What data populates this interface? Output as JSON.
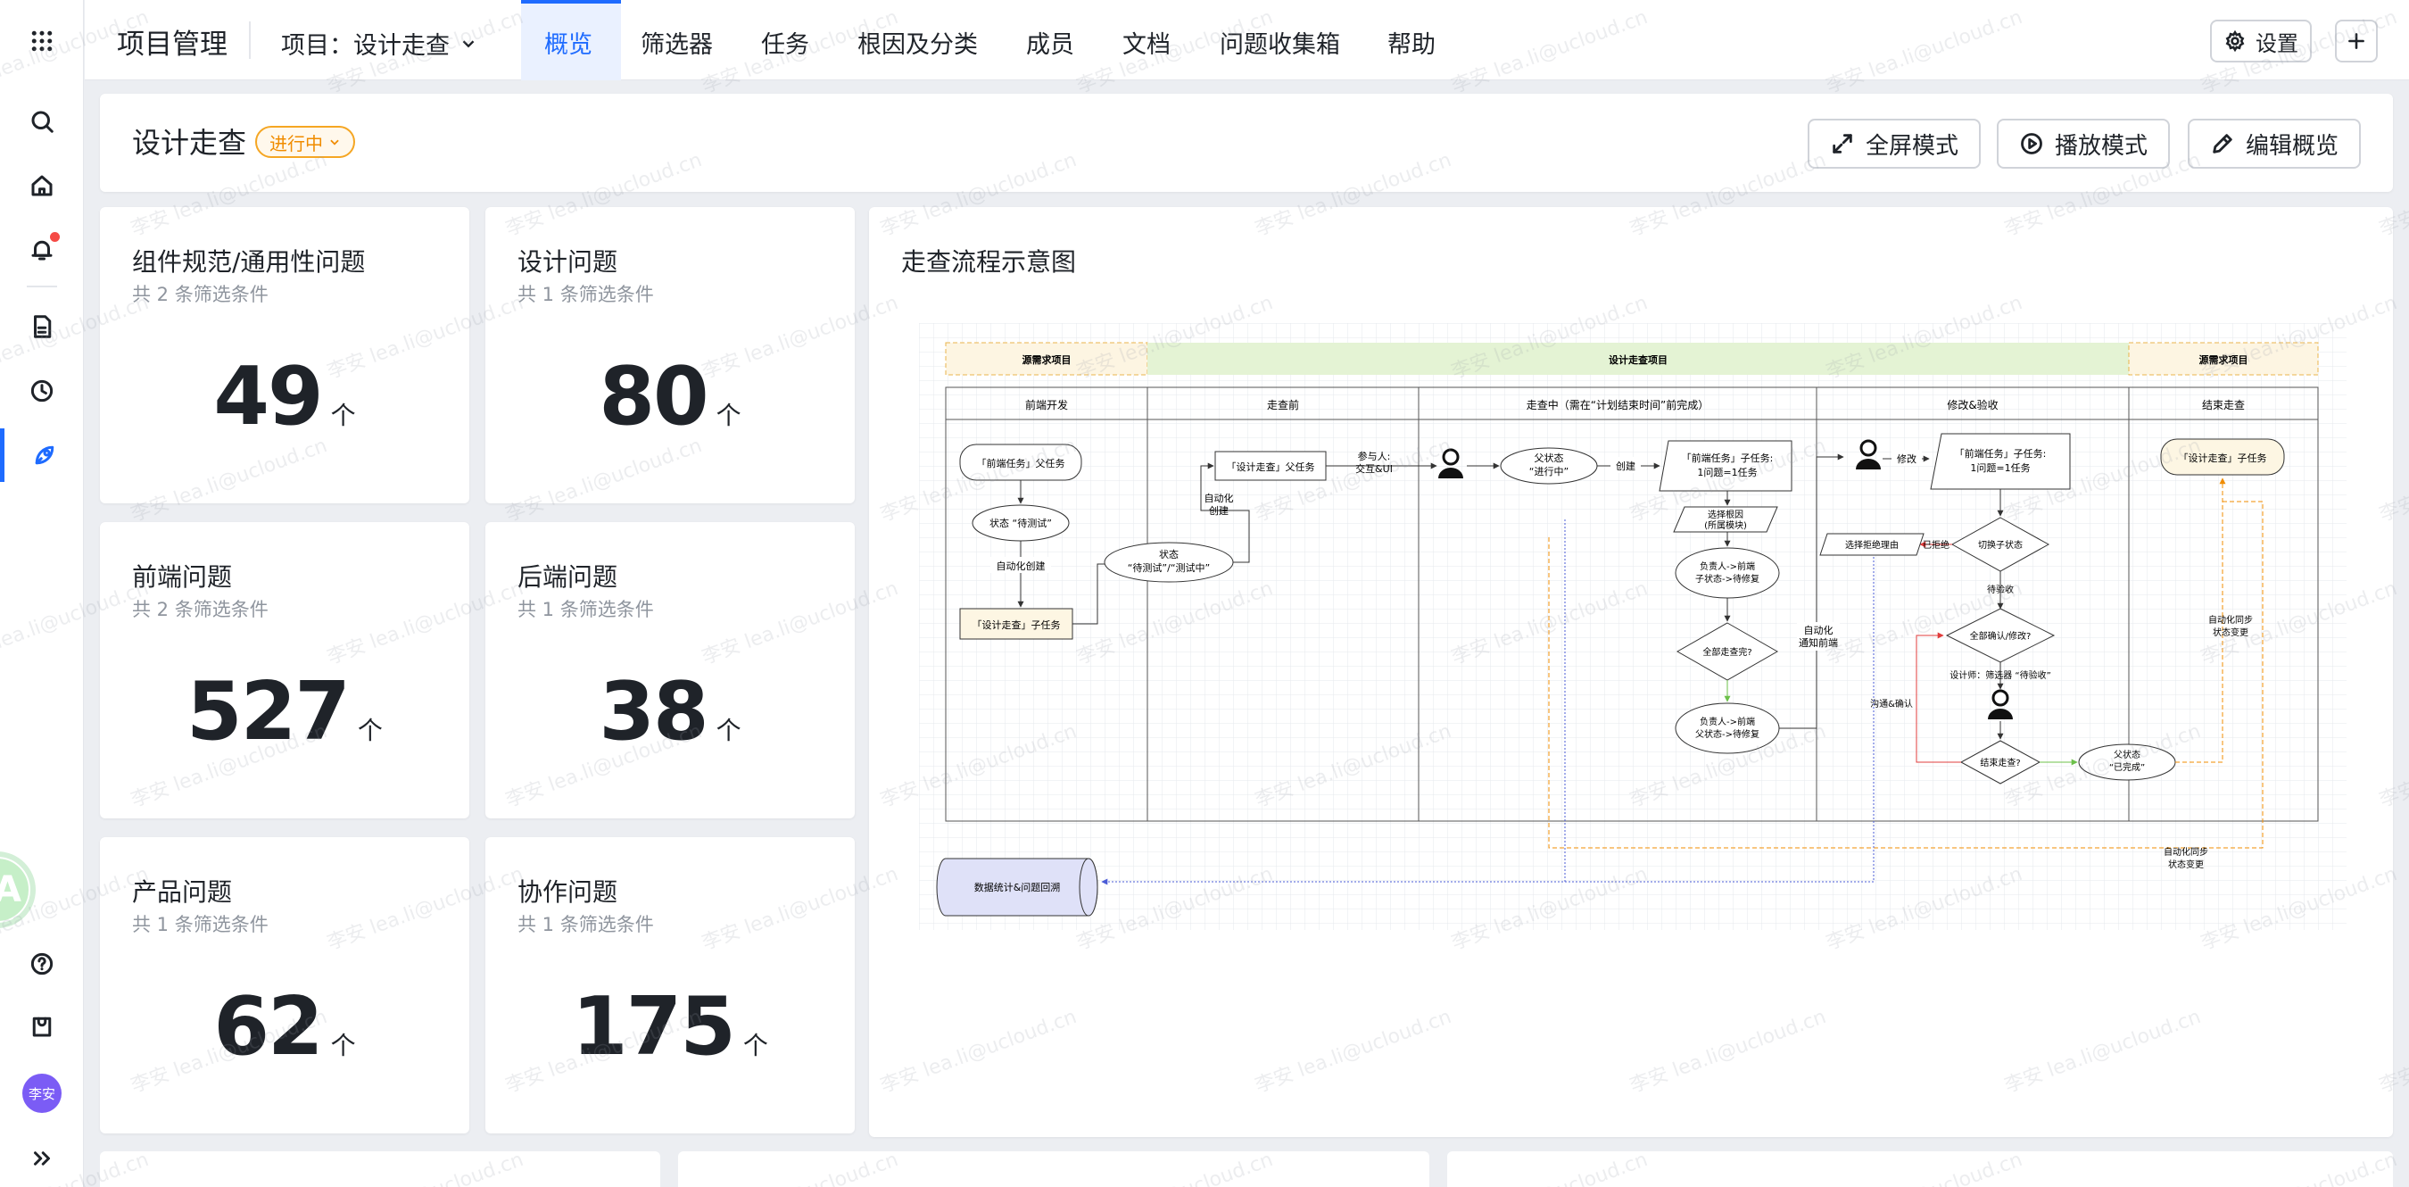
{
  "app": {
    "title": "项目管理"
  },
  "project_select": {
    "label": "项目：设计走查"
  },
  "tabs": [
    {
      "label": "概览"
    },
    {
      "label": "筛选器"
    },
    {
      "label": "任务"
    },
    {
      "label": "根因及分类"
    },
    {
      "label": "成员"
    },
    {
      "label": "文档"
    },
    {
      "label": "问题收集箱"
    },
    {
      "label": "帮助"
    }
  ],
  "topbar": {
    "settings_label": "设置"
  },
  "header": {
    "title": "设计走查",
    "status": "进行中",
    "fullscreen_label": "全屏模式",
    "play_label": "播放模式",
    "edit_label": "编辑概览"
  },
  "user": {
    "avatar_text": "李安"
  },
  "float_avatar": {
    "text": "A"
  },
  "stats": [
    {
      "title": "组件规范/通用性问题",
      "sub": "共 2 条筛选条件",
      "value": "49",
      "unit": "个"
    },
    {
      "title": "设计问题",
      "sub": "共 1 条筛选条件",
      "value": "80",
      "unit": "个"
    },
    {
      "title": "前端问题",
      "sub": "共 2 条筛选条件",
      "value": "527",
      "unit": "个"
    },
    {
      "title": "后端问题",
      "sub": "共 1 条筛选条件",
      "value": "38",
      "unit": "个"
    },
    {
      "title": "产品问题",
      "sub": "共 1 条筛选条件",
      "value": "62",
      "unit": "个"
    },
    {
      "title": "协作问题",
      "sub": "共 1 条筛选条件",
      "value": "175",
      "unit": "个"
    }
  ],
  "flow": {
    "title": "走查流程示意图",
    "band_left": "源需求项目",
    "band_mid": "设计走查项目",
    "band_right": "源需求项目",
    "col1": "前端开发",
    "col2": "走查前",
    "col3": "走查中（需在“计划结束时间”前完成）",
    "col4": "修改&验收",
    "col5": "结束走查",
    "n_fe_parent": "「前端任务」父任务",
    "n_state_test": "状态 “待测试”",
    "l_auto_create": "自动化创建",
    "n_dw_sub": "「设计走查」子任务",
    "n_state2_a": "状态",
    "n_state2_b": "“待测试”/“测试中”",
    "l_auto_create2_a": "自动化",
    "l_auto_create2_b": "创建",
    "n_dw_parent": "「设计走查」父任务",
    "l_participants_a": "参与人:",
    "l_participants_b": "交互&UI",
    "n_parent_state_a": "父状态",
    "n_parent_state_b": "“进行中”",
    "l_create": "创建",
    "n_fe_sub_a": "「前端任务」子任务:",
    "n_fe_sub_b": "1问题=1任务",
    "n_root_a": "选择根因",
    "n_root_b": "(所属模块)",
    "n_owner_a": "负责人->前端",
    "n_owner_b": "子状态->待修复",
    "n_all_done": "全部走查完?",
    "n_owner2_a": "负责人->前端",
    "n_owner2_b": "父状态->待修复",
    "l_notify_a": "自动化",
    "l_notify_b": "通知前端",
    "l_modify": "修改",
    "n_fe_sub2_a": "「前端任务」子任务:",
    "n_fe_sub2_b": "1问题=1任务",
    "n_reject": "选择拒绝理由",
    "l_rejected": "已拒绝",
    "n_switch": "切换子状态",
    "l_pending": "待验收",
    "n_all_confirm": "全部确认/修改?",
    "l_designer": "设计师：筛选器 “待验收”",
    "l_communicate": "沟通&确认",
    "n_end": "结束走查?",
    "n_parent_done_a": "父状态",
    "n_parent_done_b": "“已完成”",
    "n_dw_sub2": "「设计走查」子任务",
    "l_sync_a": "自动化同步",
    "l_sync_b": "状态变更",
    "l_sync2_a": "自动化同步",
    "l_sync2_b": "状态变更",
    "n_db": "数据统计&问题回溯"
  },
  "watermark": {
    "text": "李安 lea.li@ucloud.cn"
  }
}
